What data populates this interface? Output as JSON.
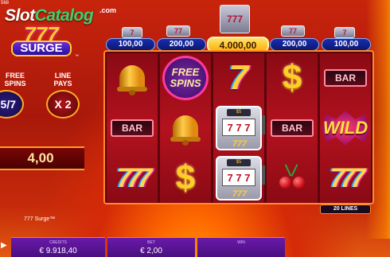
{
  "watermark": {
    "brand_part1": "Slot",
    "brand_part2": "Catalog",
    "suffix": ".com",
    "corner_number": "568"
  },
  "game_logo": {
    "top": "777",
    "bottom": "SURGE",
    "tm": "™"
  },
  "left_panel": {
    "free_spins_label_1": "FREE",
    "free_spins_label_2": "SPINS",
    "free_spins_value": "5/7",
    "line_pays_label_1": "LINE",
    "line_pays_label_2": "PAYS",
    "line_pays_value": "X 2",
    "win_value": "4,00"
  },
  "jackpots": [
    {
      "value": "100,00",
      "icon": "7"
    },
    {
      "value": "200,00",
      "icon": "77"
    },
    {
      "value": "4.000,00",
      "icon": "777"
    },
    {
      "value": "200,00",
      "icon": "77"
    },
    {
      "value": "100,00",
      "icon": "7"
    }
  ],
  "reels": [
    [
      {
        "symbol": "bell"
      },
      {
        "symbol": "bar",
        "text": "BAR"
      },
      {
        "symbol": "triple-seven",
        "text": "777"
      }
    ],
    [
      {
        "symbol": "free-spins",
        "text": "FREE SPINS"
      },
      {
        "symbol": "bell"
      },
      {
        "symbol": "dollar",
        "text": "$"
      }
    ],
    [
      {
        "symbol": "seven",
        "text": "7"
      },
      {
        "symbol": "slot-machine",
        "text": "7 7 7"
      },
      {
        "symbol": "slot-machine",
        "text": "7 7 7"
      }
    ],
    [
      {
        "symbol": "dollar",
        "text": "$"
      },
      {
        "symbol": "bar",
        "text": "BAR"
      },
      {
        "symbol": "cherry"
      }
    ],
    [
      {
        "symbol": "bar",
        "text": "BAR"
      },
      {
        "symbol": "wild",
        "text": "WILD"
      },
      {
        "symbol": "triple-seven",
        "text": "777"
      }
    ]
  ],
  "lines_badge": "20 LINES",
  "game_name": "777 Surge™",
  "bottom_bar": {
    "credits_label": "CREDITS",
    "credits_value": "€ 9.918,40",
    "bet_label": "BET",
    "bet_value": "€ 2,00",
    "win_label": "WIN",
    "win_value": ""
  },
  "colors": {
    "accent_orange": "#ff8a2a",
    "panel_purple": "#5a149a",
    "reel_red": "#b3121e"
  }
}
